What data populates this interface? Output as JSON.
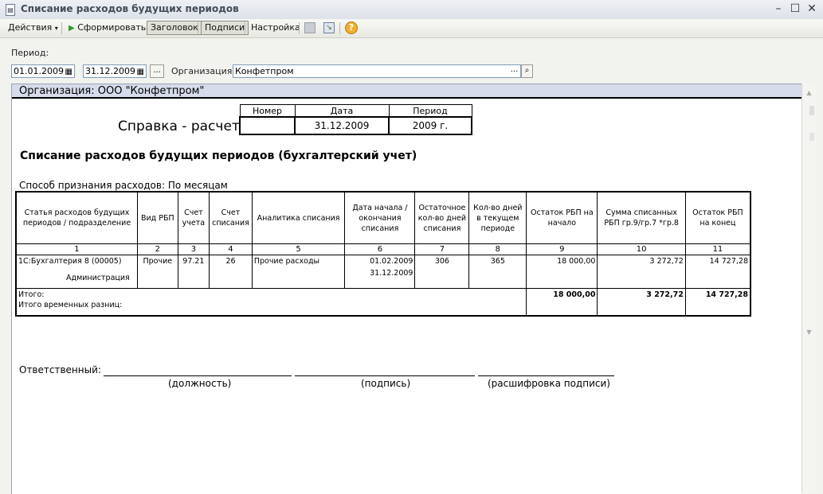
{
  "window": {
    "title": "Списание расходов будущих периодов"
  },
  "toolbar": {
    "actions": "Действия",
    "generate": "Сформировать",
    "header": "Заголовок",
    "signatures": "Подписи",
    "settings": "Настройка"
  },
  "filter": {
    "period_label": "Период:",
    "date_from": "01.01.2009",
    "date_to": "31.12.2009",
    "ellipsis": "...",
    "org_label": "Организация:",
    "org_value": "Конфетпром"
  },
  "report": {
    "org_band": "Организация: ООО \"Конфетпром\"",
    "doc_title": "Справка - расчет",
    "hdr_number": "Номер",
    "hdr_date": "Дата",
    "hdr_period": "Период",
    "val_number": "",
    "val_date": "31.12.2009",
    "val_period": "2009 г.",
    "heading": "Списание расходов будущих периодов (бухгалтерский учет)",
    "method": "Способ признания расходов: По месяцам",
    "columns": [
      "Статья расходов будущих периодов / подразделение",
      "Вид РБП",
      "Счет учета",
      "Счет списания",
      "Аналитика списания",
      "Дата начала / окончания списания",
      "Остаточное кол-во дней списания",
      "Кол-во дней в текущем периоде",
      "Остаток РБП на начало",
      "Сумма списанных РБП гр.9/гр.7 *гр.8",
      "Остаток РБП на конец"
    ],
    "col_numbers": [
      "1",
      "2",
      "3",
      "4",
      "5",
      "6",
      "7",
      "8",
      "9",
      "10",
      "11"
    ],
    "row": {
      "item": "1С:Бухгалтерия 8 (00005)",
      "subdivision": "Администрация",
      "kind": "Прочие",
      "account": "97.21",
      "write_off_account": "26",
      "analytics": "Прочие расходы",
      "date_start": "01.02.2009",
      "date_end": "31.12.2009",
      "days_left": "306",
      "days_period": "365",
      "balance_start": "18 000,00",
      "amount": "3 272,72",
      "balance_end": "14 727,28"
    },
    "total_label": "Итого:",
    "temp_diff_label": "Итого временных разниц:",
    "total_balance_start": "18 000,00",
    "total_amount": "3 272,72",
    "total_balance_end": "14 727,28",
    "responsible_label": "Ответственный:",
    "position_caption": "(должность)",
    "signature_caption": "(подпись)",
    "decoding_caption": "(расшифровка подписи)"
  }
}
